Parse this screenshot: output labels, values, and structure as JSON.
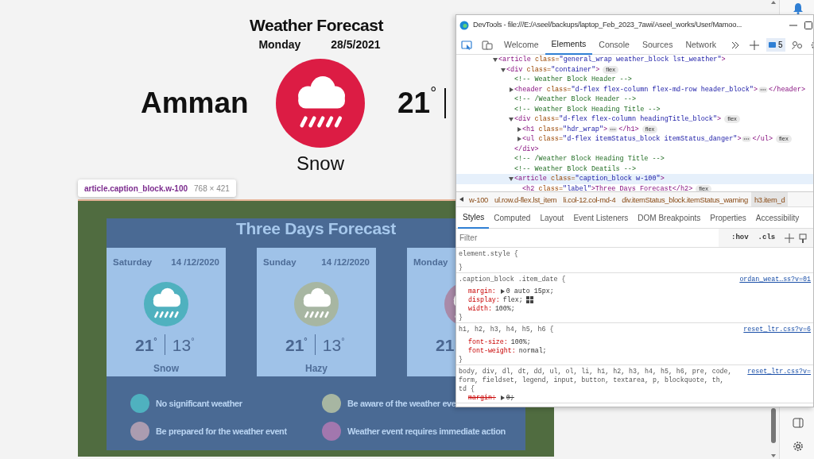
{
  "page": {
    "title": "Weather Forecast",
    "day": "Monday",
    "date": "28/5/2021",
    "city": "Amman",
    "temp": "21$^{°}$",
    "condition": "Snow",
    "color": "#dc1c44"
  },
  "inspect_tooltip": {
    "selector": "article.caption_block.w-100",
    "size": "768 × 421"
  },
  "forecast": {
    "title": "Three Days Forecast",
    "days": [
      {
        "day": "Saturday",
        "date": "14 /12/2020",
        "color": "#4fb1bf",
        "high": "21$^{°}$",
        "low": "13$^{°}$",
        "condition": "Snow"
      },
      {
        "day": "Sunday",
        "date": "14 /12/2020",
        "color": "#a7b6a2",
        "high": "21$^{°}$",
        "low": "13$^{°}$",
        "condition": "Hazy"
      },
      {
        "day": "Monday",
        "color": "#a98aa8",
        "high": "21"
      }
    ],
    "legend": [
      {
        "color": "#4fb1bf",
        "label": "No significant weather"
      },
      {
        "color": "#a7b6a2",
        "label": "Be aware of the weather eve"
      },
      {
        "color": "#ab9cb0",
        "label": "Be prepared for the weather event"
      },
      {
        "color": "#a277ae",
        "label": "Weather event requires immediate action"
      }
    ]
  },
  "devtools": {
    "title": "DevTools - file:///E:/Aseel/backups/laptop_Feb_2023_7awi/Aseel_works/User/Mamoo...",
    "tabs": [
      {
        "label": "Welcome",
        "selected": false
      },
      {
        "label": "Elements",
        "selected": true
      },
      {
        "label": "Console",
        "selected": false
      },
      {
        "label": "Sources",
        "selected": false
      },
      {
        "label": "Network",
        "selected": false
      }
    ],
    "issues": "5",
    "dom": [
      {
        "kind": "node",
        "open": "<article class=\"general_wrap weather_block lst_weather\">",
        "expanded": true,
        "selected": false,
        "children": [
          {
            "kind": "node",
            "open": "<div class=\"container\">",
            "badge": "flex",
            "expanded": true,
            "selected": false,
            "children": [
              {
                "kind": "comment",
                "text": "<!-- Weather Block Header -->",
                "selected": false
              },
              {
                "kind": "node",
                "open": "<header class=\"d-flex flex-column flex-md-row header_block\">",
                "close": "</header>",
                "expanded": false,
                "selected": false
              },
              {
                "kind": "comment",
                "text": "<!-- /Weather Block Header -->",
                "selected": false
              },
              {
                "kind": "comment",
                "text": "<!-- Weather Block Heading Title -->",
                "selected": false
              },
              {
                "kind": "node",
                "open": "<div class=\"d-flex flex-column headingTitle_block\">",
                "badge": "flex",
                "expanded": true,
                "selected": false,
                "end": "</div>",
                "children": [
                  {
                    "kind": "node",
                    "open": "<h1 class=\"hdr_wrap\">",
                    "close": "</h1>",
                    "badge": "flex",
                    "expanded": false,
                    "selected": false
                  },
                  {
                    "kind": "node",
                    "open": "<ul class=\"d-flex itemStatus_block itemStatus_danger\">",
                    "close": "</ul>",
                    "badge": "flex",
                    "expanded": false,
                    "selected": false
                  }
                ]
              },
              {
                "kind": "comment",
                "text": "<!-- /Weather Block Heading Title -->",
                "selected": false
              },
              {
                "kind": "comment",
                "text": "<!-- Weather Block Deatils -->",
                "selected": false
              },
              {
                "kind": "node",
                "open": "<article class=\"caption_block w-100\">",
                "expanded": true,
                "selected": true,
                "children": [
                  {
                    "kind": "leaf",
                    "open": "<h2 class=\"label\">Three Days Forecast</h2>",
                    "badge": "flex",
                    "selected": false
                  }
                ]
              }
            ]
          }
        ]
      }
    ],
    "breadcrumbs": [
      {
        "label": "w-100",
        "selected": false
      },
      {
        "label": "ul.row.d-flex.lst_item",
        "selected": false
      },
      {
        "label": "li.col-12.col-md-4",
        "selected": false
      },
      {
        "label": "div.itemStatus_block.itemStatus_warning",
        "selected": false
      },
      {
        "label": "h3.item_d",
        "selected": true
      }
    ],
    "style_tabs": [
      {
        "label": "Styles",
        "selected": true
      },
      {
        "label": "Computed",
        "selected": false
      },
      {
        "label": "Layout",
        "selected": false
      },
      {
        "label": "Event Listeners",
        "selected": false
      },
      {
        "label": "DOM Breakpoints",
        "selected": false
      },
      {
        "label": "Properties",
        "selected": false
      },
      {
        "label": "Accessibility",
        "selected": false
      }
    ],
    "filter": {
      "placeholder": "Filter",
      "hov": ":hov",
      "cls": ".cls"
    },
    "rules": [
      {
        "selector_lines": [
          "element.style {"
        ],
        "close": "}"
      },
      {
        "selector_lines": [
          ".caption_block .item_date {"
        ],
        "source": "ordan_weat…ss?v=01",
        "close": "}",
        "declarations": [
          {
            "prop": "margin:",
            "value": "0 auto 15px;",
            "expandable": true,
            "struck": false
          },
          {
            "prop": "display:",
            "value": "flex;",
            "grid_editor": true,
            "struck": false
          },
          {
            "prop": "width:",
            "value": "100%;",
            "struck": false
          }
        ]
      },
      {
        "selector_lines": [
          "h1, h2, h3, h4, h5, h6 {"
        ],
        "source": "reset_ltr.css?v=6",
        "close": "}",
        "declarations": [
          {
            "prop": "font-size:",
            "value": "100%;",
            "struck": false
          },
          {
            "prop": "font-weight:",
            "value": "normal;",
            "struck": false
          }
        ]
      },
      {
        "selector_lines": [
          "body, div, dl, dt, dd, ul, ol, li, h1, h2, h3, h4, h5, h6, pre, code,",
          "form, fieldset, legend, input, button, textarea, p, blockquote, th,",
          "td {"
        ],
        "source": "reset_ltr.css?v=",
        "declarations": [
          {
            "prop": "margin:",
            "value": "0;",
            "expandable": true,
            "struck": true
          }
        ]
      }
    ]
  }
}
